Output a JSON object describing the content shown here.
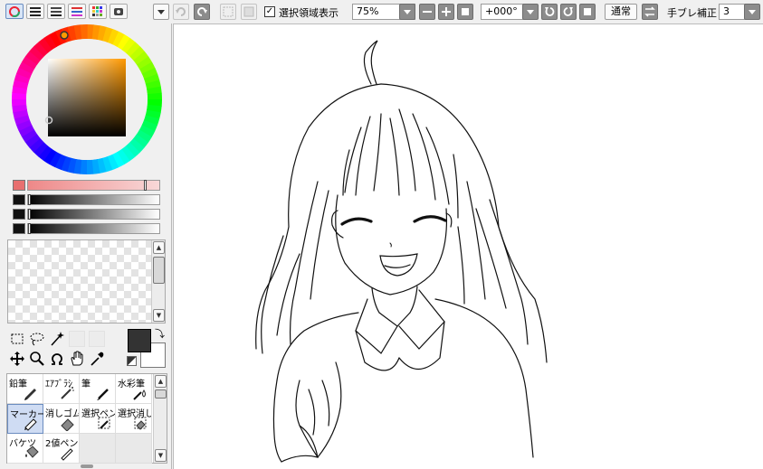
{
  "toolbar": {
    "selection_toggle_label": "選択領域表示",
    "zoom_value": "75%",
    "rotation_value": "+000°",
    "blend_mode": "通常",
    "stabilizer_label": "手ブレ補正",
    "stabilizer_value": "3"
  },
  "color": {
    "current_hue": "#ff9900",
    "foreground": "#333333",
    "background": "#ffffff"
  },
  "brushes": [
    {
      "label": "鉛筆",
      "icon": "pencil-icon"
    },
    {
      "label": "ｴｱﾌﾞﾗｼ",
      "icon": "airbrush-icon"
    },
    {
      "label": "筆",
      "icon": "brush-icon"
    },
    {
      "label": "水彩筆",
      "icon": "watercolor-icon"
    },
    {
      "label": "マーカー",
      "icon": "marker-icon",
      "selected": true
    },
    {
      "label": "消しゴム",
      "icon": "eraser-icon"
    },
    {
      "label": "選択ペン",
      "icon": "selection-pen-icon"
    },
    {
      "label": "選択消し",
      "icon": "selection-erase-icon"
    },
    {
      "label": "バケツ",
      "icon": "bucket-icon"
    },
    {
      "label": "2値ペン",
      "icon": "binary-pen-icon"
    }
  ]
}
